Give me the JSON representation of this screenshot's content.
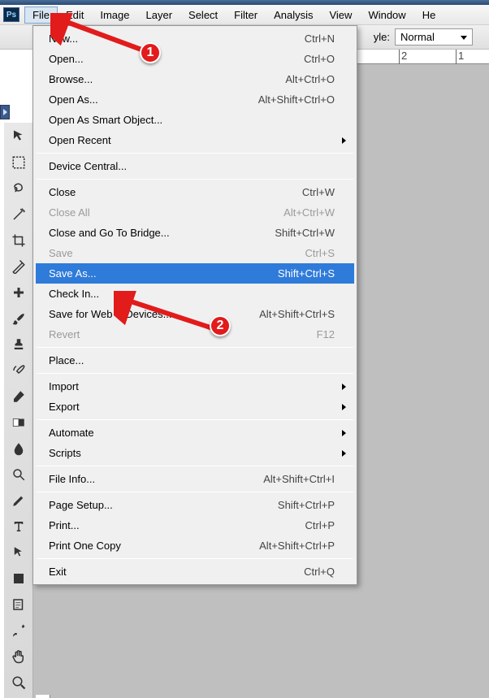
{
  "menubar": {
    "items": [
      "File",
      "Edit",
      "Image",
      "Layer",
      "Select",
      "Filter",
      "Analysis",
      "View",
      "Window",
      "He"
    ],
    "active_index": 0
  },
  "toolbar": {
    "style_label": "yle:",
    "style_value": "Normal"
  },
  "ruler": {
    "ticks": [
      "2",
      "1"
    ]
  },
  "annotations": {
    "badge1": "1",
    "badge2": "2"
  },
  "dropdown": {
    "groups": [
      [
        {
          "label": "New...",
          "shortcut": "Ctrl+N"
        },
        {
          "label": "Open...",
          "shortcut": "Ctrl+O"
        },
        {
          "label": "Browse...",
          "shortcut": "Alt+Ctrl+O"
        },
        {
          "label": "Open As...",
          "shortcut": "Alt+Shift+Ctrl+O"
        },
        {
          "label": "Open As Smart Object..."
        },
        {
          "label": "Open Recent",
          "submenu": true
        }
      ],
      [
        {
          "label": "Device Central..."
        }
      ],
      [
        {
          "label": "Close",
          "shortcut": "Ctrl+W"
        },
        {
          "label": "Close All",
          "shortcut": "Alt+Ctrl+W",
          "disabled": true
        },
        {
          "label": "Close and Go To Bridge...",
          "shortcut": "Shift+Ctrl+W"
        },
        {
          "label": "Save",
          "shortcut": "Ctrl+S",
          "disabled": true
        },
        {
          "label": "Save As...",
          "shortcut": "Shift+Ctrl+S",
          "selected": true
        },
        {
          "label": "Check In..."
        },
        {
          "label": "Save for Web & Devices...",
          "shortcut": "Alt+Shift+Ctrl+S"
        },
        {
          "label": "Revert",
          "shortcut": "F12",
          "disabled": true
        }
      ],
      [
        {
          "label": "Place..."
        }
      ],
      [
        {
          "label": "Import",
          "submenu": true
        },
        {
          "label": "Export",
          "submenu": true
        }
      ],
      [
        {
          "label": "Automate",
          "submenu": true
        },
        {
          "label": "Scripts",
          "submenu": true
        }
      ],
      [
        {
          "label": "File Info...",
          "shortcut": "Alt+Shift+Ctrl+I"
        }
      ],
      [
        {
          "label": "Page Setup...",
          "shortcut": "Shift+Ctrl+P"
        },
        {
          "label": "Print...",
          "shortcut": "Ctrl+P"
        },
        {
          "label": "Print One Copy",
          "shortcut": "Alt+Shift+Ctrl+P"
        }
      ],
      [
        {
          "label": "Exit",
          "shortcut": "Ctrl+Q"
        }
      ]
    ]
  },
  "tools": [
    "move-tool",
    "marquee-tool",
    "lasso-tool",
    "wand-tool",
    "crop-tool",
    "slice-tool",
    "healing-tool",
    "brush-tool",
    "stamp-tool",
    "history-brush-tool",
    "eraser-tool",
    "gradient-tool",
    "blur-tool",
    "dodge-tool",
    "pen-tool",
    "type-tool",
    "path-select-tool",
    "shape-tool",
    "notes-tool",
    "eyedropper-tool",
    "hand-tool",
    "zoom-tool"
  ],
  "ps_label": "Ps"
}
